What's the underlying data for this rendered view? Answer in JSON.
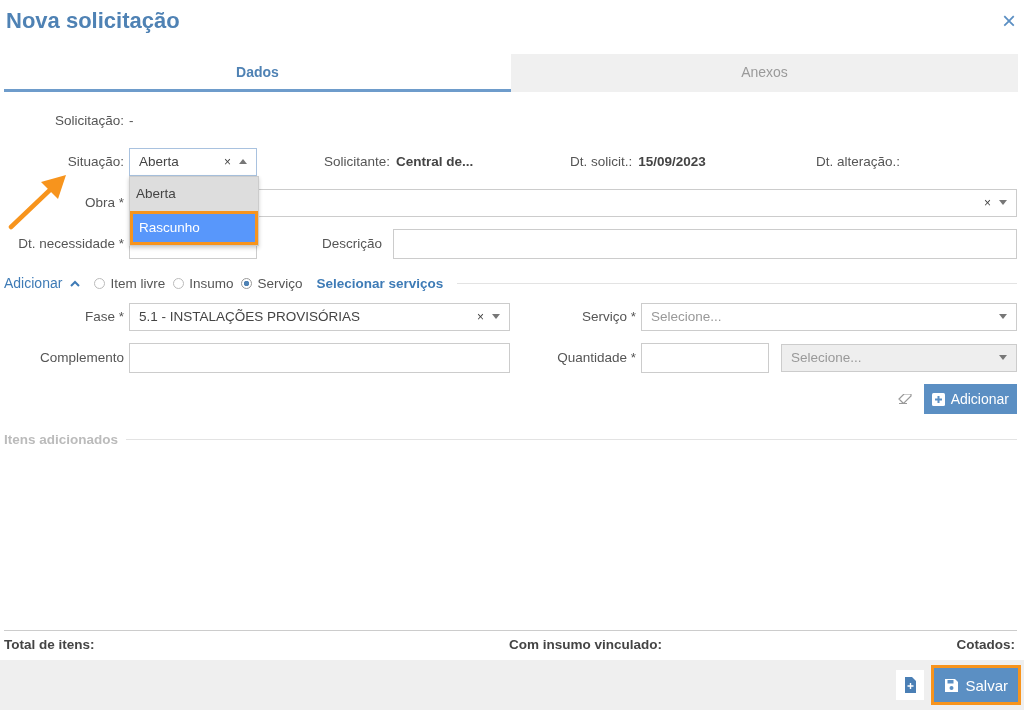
{
  "dialog": {
    "title": "Nova solicitação",
    "close": "×"
  },
  "tabs": [
    {
      "label": "Dados",
      "selected": true
    },
    {
      "label": "Anexos",
      "selected": false
    }
  ],
  "header": {
    "solicitacao": {
      "label": "Solicitação:",
      "value": "-"
    },
    "situacao": {
      "label": "Situação:",
      "value": "Aberta",
      "clear": "×",
      "expanded": true,
      "options": [
        {
          "label": "Aberta",
          "selected": true,
          "hovered": false,
          "highlighted": false
        },
        {
          "label": "Rascunho",
          "selected": false,
          "hovered": true,
          "highlighted": true
        }
      ]
    },
    "info": [
      {
        "label": "Solicitante:",
        "value": "Central de..."
      },
      {
        "label": "Dt. solicit.:",
        "value": "15/09/2023"
      },
      {
        "label": "Dt. alteração.:"
      }
    ],
    "obra": {
      "label": "Obra *",
      "clear": "×"
    },
    "dt_necessidade": {
      "label": "Dt. necessidade *"
    },
    "descricao": {
      "label": "Descrição"
    }
  },
  "adicionar": {
    "label": "Adicionar",
    "expanded": true,
    "types": [
      {
        "label": "Item livre",
        "selected": false
      },
      {
        "label": "Insumo",
        "selected": false
      },
      {
        "label": "Serviço",
        "selected": true
      }
    ],
    "link": "Selecionar serviços",
    "fase": {
      "label": "Fase *",
      "value": "5.1 - INSTALAÇÕES PROVISÓRIAS",
      "clear": "×"
    },
    "servico": {
      "label": "Serviço *",
      "placeholder": "Selecione..."
    },
    "complemento": {
      "label": "Complemento"
    },
    "quantidade": {
      "label": "Quantidade *"
    },
    "unidade": {
      "placeholder": "Selecione...",
      "disabled": true
    },
    "button": "Adicionar"
  },
  "items_section": {
    "title": "Itens adicionados"
  },
  "totals": [
    "Total de itens:",
    "Com insumo vinculado:",
    "Cotados:"
  ],
  "footer": {
    "save": "Salvar",
    "save_highlighted": true
  }
}
